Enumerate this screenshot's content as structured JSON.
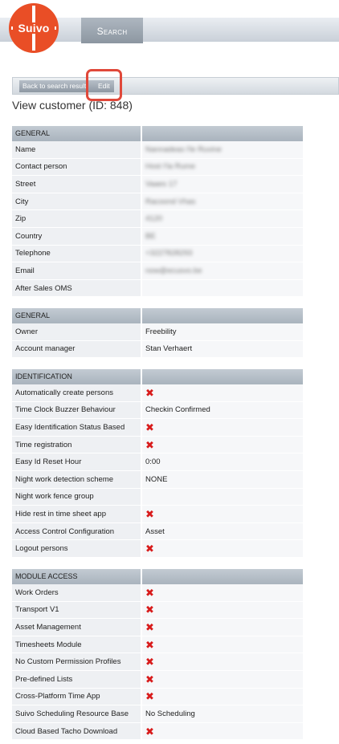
{
  "header": {
    "logo_text": "Suivo",
    "search_tab": "Search"
  },
  "toolbar": {
    "back_label": "Back to search result",
    "edit_label": "Edit"
  },
  "page_title": "View customer (ID: 848)",
  "colors": {
    "brand_orange": "#e94e26",
    "header_gray": "#a9b3bd",
    "cross_red": "#d81b1b",
    "annotation_red": "#e0483a"
  },
  "sections": [
    {
      "title": "GENERAL",
      "rows": [
        {
          "label": "Name",
          "value": "Nannadeas l'le Ruvine",
          "type": "blurred"
        },
        {
          "label": "Contact person",
          "value": "Host I'la Rume",
          "type": "blurred"
        },
        {
          "label": "Street",
          "value": "Vaaes 17",
          "type": "blurred"
        },
        {
          "label": "City",
          "value": "Racoond Vhas",
          "type": "blurred"
        },
        {
          "label": "Zip",
          "value": "4120",
          "type": "blurred"
        },
        {
          "label": "Country",
          "value": "BE",
          "type": "blurred"
        },
        {
          "label": "Telephone",
          "value": "+3227828293",
          "type": "blurred"
        },
        {
          "label": "Email",
          "value": "now@ecusvo.be",
          "type": "blurred"
        },
        {
          "label": "After Sales OMS",
          "value": "",
          "type": "text"
        }
      ]
    },
    {
      "title": "GENERAL",
      "rows": [
        {
          "label": "Owner",
          "value": "Freebility",
          "type": "text"
        },
        {
          "label": "Account manager",
          "value": "Stan Verhaert",
          "type": "text"
        }
      ]
    },
    {
      "title": "IDENTIFICATION",
      "rows": [
        {
          "label": "Automatically create persons",
          "value": "✖",
          "type": "cross"
        },
        {
          "label": "Time Clock Buzzer Behaviour",
          "value": "Checkin Confirmed",
          "type": "text"
        },
        {
          "label": "Easy Identification Status Based",
          "value": "✖",
          "type": "cross"
        },
        {
          "label": "Time registration",
          "value": "✖",
          "type": "cross"
        },
        {
          "label": "Easy Id Reset Hour",
          "value": "0:00",
          "type": "text"
        },
        {
          "label": "Night work detection scheme",
          "value": "NONE",
          "type": "text"
        },
        {
          "label": "Night work fence group",
          "value": "",
          "type": "text"
        },
        {
          "label": "Hide rest in time sheet app",
          "value": "✖",
          "type": "cross"
        },
        {
          "label": "Access Control Configuration",
          "value": "Asset",
          "type": "text"
        },
        {
          "label": "Logout persons",
          "value": "✖",
          "type": "cross"
        }
      ]
    },
    {
      "title": "MODULE ACCESS",
      "rows": [
        {
          "label": "Work Orders",
          "value": "✖",
          "type": "cross"
        },
        {
          "label": "Transport V1",
          "value": "✖",
          "type": "cross"
        },
        {
          "label": "Asset Management",
          "value": "✖",
          "type": "cross"
        },
        {
          "label": "Timesheets Module",
          "value": "✖",
          "type": "cross"
        },
        {
          "label": "No Custom Permission Profiles",
          "value": "✖",
          "type": "cross"
        },
        {
          "label": "Pre-defined Lists",
          "value": "✖",
          "type": "cross"
        },
        {
          "label": "Cross-Platform Time App",
          "value": "✖",
          "type": "cross"
        },
        {
          "label": "Suivo Scheduling Resource Base",
          "value": "No Scheduling",
          "type": "text"
        },
        {
          "label": "Cloud Based Tacho Download",
          "value": "✖",
          "type": "cross"
        }
      ]
    }
  ]
}
